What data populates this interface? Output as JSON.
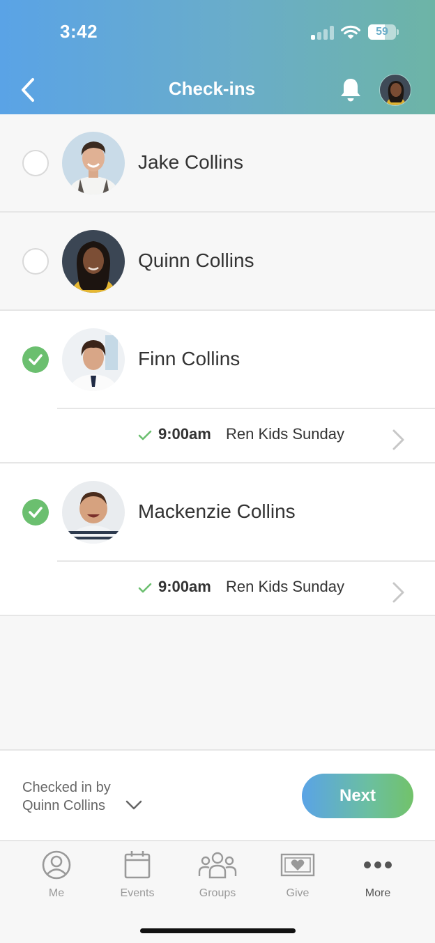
{
  "status_bar": {
    "time": "3:42",
    "battery_percent": "59",
    "battery_level": 0.59,
    "signal_bars_active": 1
  },
  "header": {
    "title": "Check-ins"
  },
  "people": [
    {
      "name": "Jake Collins",
      "checked": false
    },
    {
      "name": "Quinn Collins",
      "checked": false
    },
    {
      "name": "Finn Collins",
      "checked": true,
      "checkin": {
        "time": "9:00am",
        "event": "Ren Kids Sunday"
      }
    },
    {
      "name": "Mackenzie Collins",
      "checked": true,
      "checkin": {
        "time": "9:00am",
        "event": "Ren Kids Sunday"
      }
    }
  ],
  "footer": {
    "checked_in_by_label": "Checked in by",
    "checked_in_by_name": "Quinn Collins",
    "next_label": "Next"
  },
  "tabs": [
    {
      "label": "Me",
      "icon": "person-circle-icon"
    },
    {
      "label": "Events",
      "icon": "calendar-icon"
    },
    {
      "label": "Groups",
      "icon": "groups-icon"
    },
    {
      "label": "Give",
      "icon": "give-icon"
    },
    {
      "label": "More",
      "icon": "more-icon"
    }
  ],
  "colors": {
    "accent_green": "#6bbf6f",
    "header_blue": "#5aa3e6",
    "header_teal": "#6db4a6"
  }
}
